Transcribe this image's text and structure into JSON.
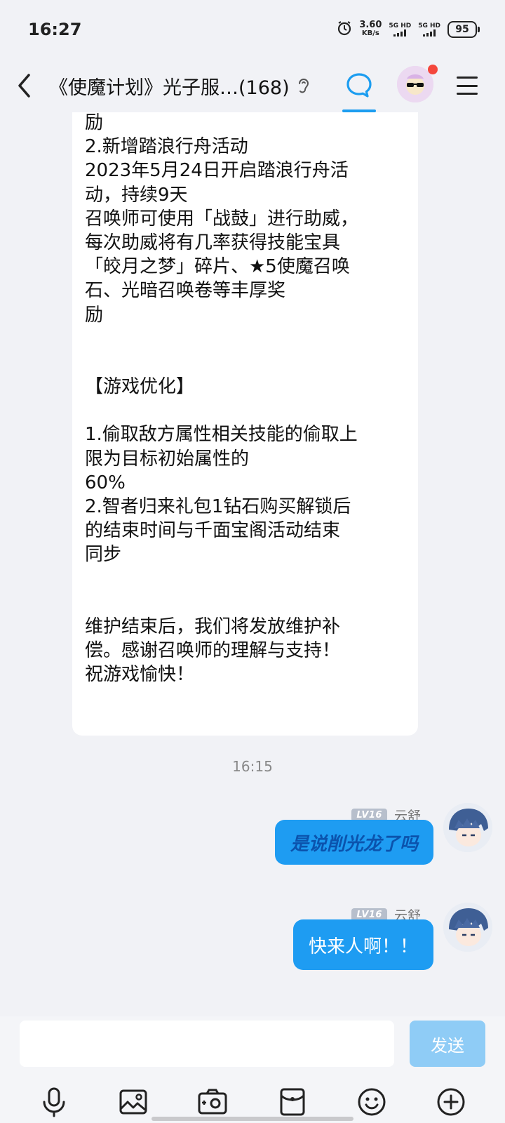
{
  "status_bar": {
    "time": "16:27",
    "net_speed_value": "3.60",
    "net_speed_unit": "KB/s",
    "signal1_label": "5G HD",
    "signal2_label": "5G HD",
    "battery": "95",
    "icons": [
      "alarm-icon",
      "signal-icon",
      "battery-icon"
    ]
  },
  "header": {
    "title": "《使魔计划》光子服…(168)",
    "icons": [
      "back-chevron-icon",
      "ear-icon",
      "chat-bubble-icon",
      "group-avatar",
      "menu-icon"
    ],
    "accent_color": "#1c9df0"
  },
  "notice": {
    "lines": [
      "励",
      "2.新增踏浪行舟活动",
      "2023年5月24日开启踏浪行舟活",
      "动，持续9天",
      "召唤师可使用「战鼓」进行助威，",
      "每次助威将有几率获得技能宝具",
      "「皎月之梦」碎片、★5使魔召唤",
      "石、光暗召唤卷等丰厚奖",
      "励",
      "",
      "",
      "【游戏优化】",
      "",
      "1.偷取敌方属性相关技能的偷取上",
      "限为目标初始属性的",
      "60%",
      "2.智者归来礼包1钻石购买解锁后",
      "的结束时间与千面宝阁活动结束",
      "同步",
      "",
      "",
      "维护结束后，我们将发放维护补",
      "偿。感谢召唤师的理解与支持！",
      "祝游戏愉快！"
    ]
  },
  "timestamp": "16:15",
  "messages": [
    {
      "badge": "LV16",
      "sender": "云舒",
      "text": "是说削光龙了吗"
    },
    {
      "badge": "LV16",
      "sender": "云舒",
      "text": "快来人啊！！"
    }
  ],
  "input": {
    "placeholder": "",
    "send_label": "发送",
    "send_color": "#8fccf6"
  },
  "toolbar_icons": [
    "microphone-icon",
    "image-icon",
    "camera-icon",
    "red-packet-icon",
    "emoji-icon",
    "plus-icon"
  ]
}
